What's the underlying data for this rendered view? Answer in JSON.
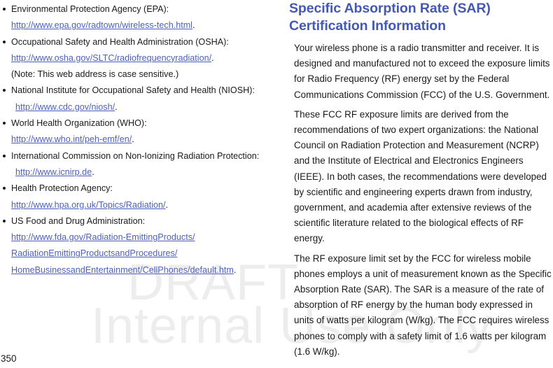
{
  "page": {
    "number": "350",
    "watermark": {
      "line1": "DRAFT",
      "line2": "Internal Use Only",
      "color": "#ededed"
    }
  },
  "colors": {
    "heading": "#4558b4",
    "link": "#4c5fc0",
    "body_text": "#1a1a1a"
  },
  "left_column": {
    "references": [
      {
        "title": "Environmental Protection Agency (EPA):",
        "lines": [
          {
            "text": "http://www.epa.gov/radtown/wireless-tech.html",
            "type": "link",
            "trailing": ".",
            "indent": false
          }
        ]
      },
      {
        "title": "Occupational Safety and Health Administration (OSHA):",
        "lines": [
          {
            "text": "http://www.osha.gov/SLTC/radiofrequencyradiation/",
            "type": "link",
            "trailing": ".",
            "indent": false
          },
          {
            "text": "(Note: This web address is case sensitive.)",
            "type": "note",
            "trailing": "",
            "indent": false
          }
        ]
      },
      {
        "title": "National Institute for Occupational Safety and Health (NIOSH):",
        "lines": [
          {
            "text": "http://www.cdc.gov/niosh/",
            "type": "link",
            "trailing": ".",
            "indent": true
          }
        ]
      },
      {
        "title": "World Health Organization (WHO):",
        "lines": [
          {
            "text": "http://www.who.int/peh-emf/en/",
            "type": "link",
            "trailing": ".",
            "indent": false
          }
        ]
      },
      {
        "title": "International Commission on Non-Ionizing Radiation Protection:",
        "lines": [
          {
            "text": "http://www.icnirp.de",
            "type": "link",
            "trailing": ".",
            "indent": true
          }
        ]
      },
      {
        "title": "Health Protection Agency:",
        "lines": [
          {
            "text": "http://www.hpa.org.uk/Topics/Radiation/",
            "type": "link",
            "trailing": ".",
            "indent": false
          }
        ]
      },
      {
        "title": "US Food and Drug Administration:",
        "lines": [
          {
            "text": "http://www.fda.gov/Radiation-EmittingProducts/",
            "type": "link",
            "trailing": "",
            "indent": false
          },
          {
            "text": "RadiationEmittingProductsandProcedures/",
            "type": "link",
            "trailing": "",
            "indent": false
          },
          {
            "text": "HomeBusinessandEntertainment/CellPhones/default.htm",
            "type": "link",
            "trailing": ".",
            "indent": false
          }
        ]
      }
    ]
  },
  "right_column": {
    "heading": "Specific Absorption Rate (SAR) Certification Information",
    "paragraphs": [
      "Your wireless phone is a radio transmitter and receiver. It is designed and manufactured not to exceed the exposure limits for Radio Frequency (RF) energy set by the Federal Communications Commission (FCC) of the U.S. Government.",
      "These FCC RF exposure limits are derived from the recommendations of two expert organizations: the National Council on Radiation Protection and Measurement (NCRP) and the Institute of Electrical and Electronics Engineers (IEEE). In both cases, the recommendations were developed by scientific and engineering experts drawn from industry, government, and academia after extensive reviews of the scientific literature related to the biological effects of RF energy.",
      "The RF exposure limit set by the FCC for wireless mobile phones employs a unit of measurement known as the Specific Absorption Rate (SAR). The SAR is a measure of the rate of absorption of RF energy by the human body expressed in units of watts per kilogram (W/kg). The FCC requires wireless phones to comply with a safety limit of 1.6 watts per kilogram (1.6 W/kg)."
    ]
  }
}
